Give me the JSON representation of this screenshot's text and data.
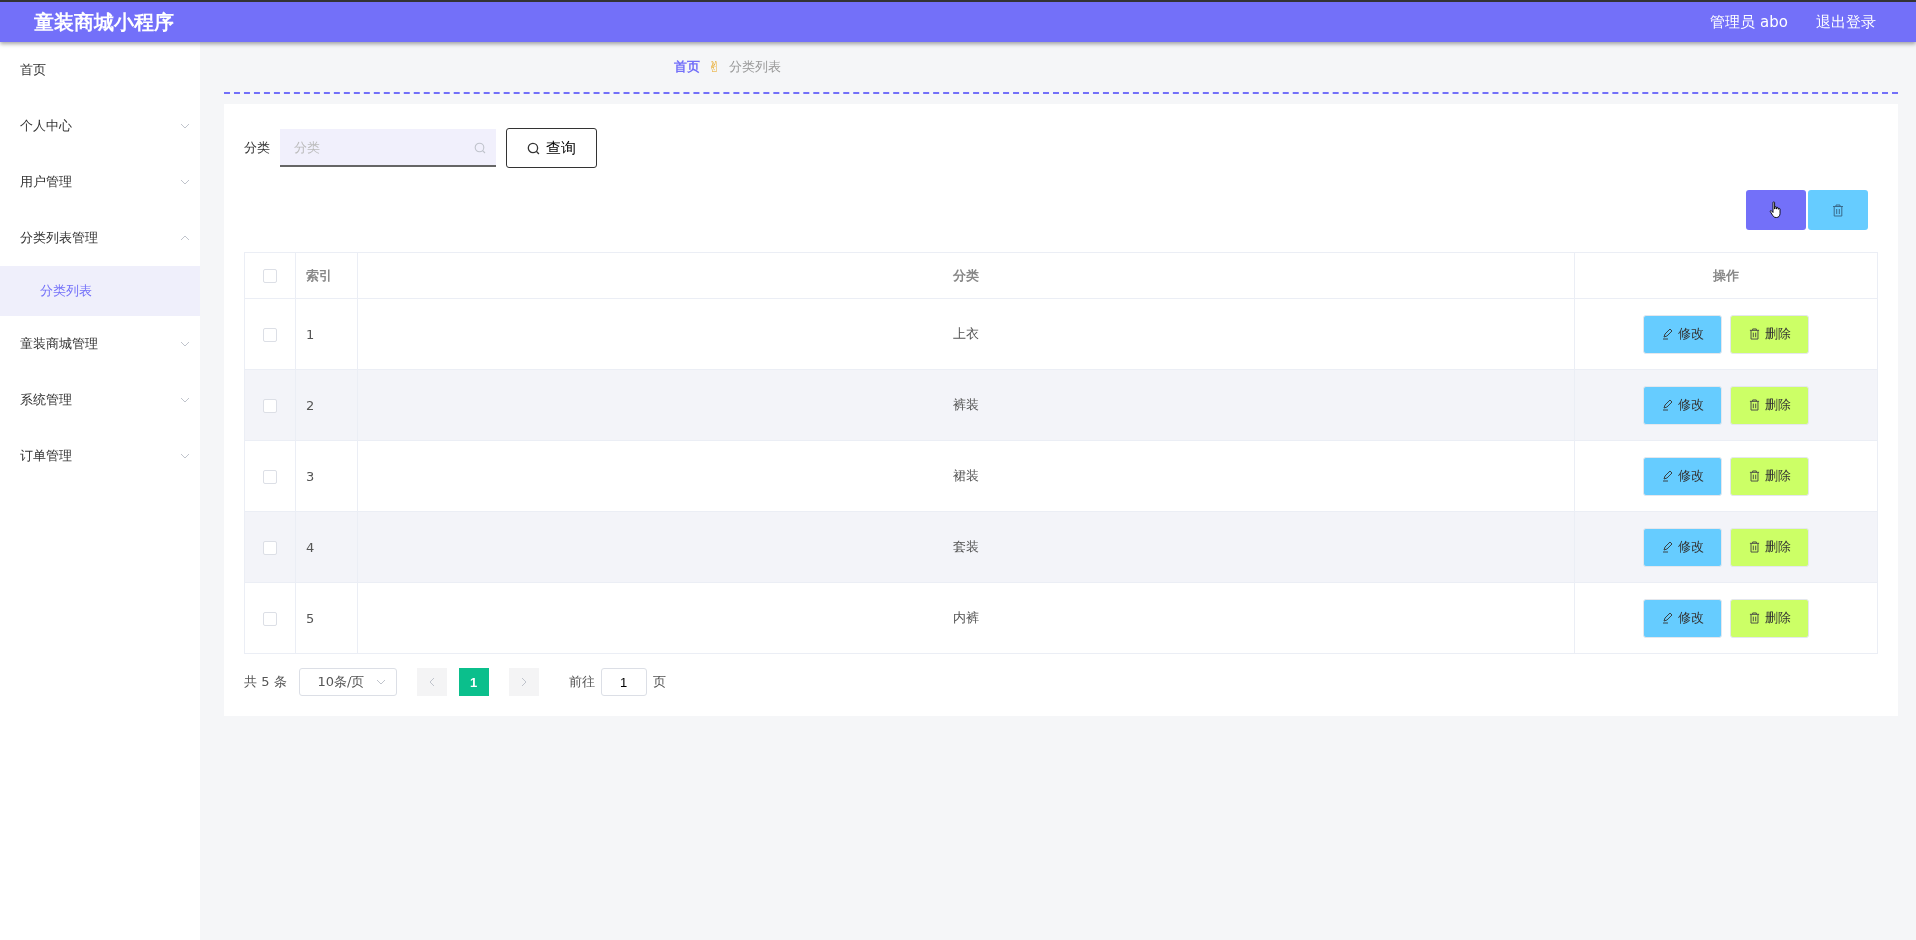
{
  "header": {
    "title": "童装商城小程序",
    "user": "管理员 abo",
    "logout": "退出登录"
  },
  "sidebar": {
    "items": [
      {
        "label": "首页"
      },
      {
        "label": "个人中心",
        "expanded": false
      },
      {
        "label": "用户管理",
        "expanded": false
      },
      {
        "label": "分类列表管理",
        "expanded": true,
        "children": [
          {
            "label": "分类列表",
            "selected": true
          }
        ]
      },
      {
        "label": "童装商城管理",
        "expanded": false
      },
      {
        "label": "系统管理",
        "expanded": false
      },
      {
        "label": "订单管理",
        "expanded": false
      }
    ]
  },
  "breadcrumb": {
    "items": [
      "首页",
      "分类列表"
    ],
    "separator": "✌"
  },
  "search": {
    "label": "分类",
    "placeholder": "分类",
    "button": "查询"
  },
  "table": {
    "all_checked": false,
    "columns": [
      "索引",
      "分类",
      "操作"
    ],
    "rows": [
      {
        "index": "1",
        "category": "上衣",
        "checked": false,
        "actions": [
          "修改",
          "删除"
        ]
      },
      {
        "index": "2",
        "category": "裤装",
        "checked": false,
        "actions": [
          "修改",
          "删除"
        ]
      },
      {
        "index": "3",
        "category": "裙装",
        "checked": false,
        "actions": [
          "修改",
          "删除"
        ]
      },
      {
        "index": "4",
        "category": "套装",
        "checked": false,
        "actions": [
          "修改",
          "删除"
        ]
      },
      {
        "index": "5",
        "category": "内裤",
        "checked": false,
        "actions": [
          "修改",
          "删除"
        ]
      }
    ]
  },
  "pagination": {
    "total": "共 5 条",
    "page_size": "10条/页",
    "pages": [
      {
        "label": "1",
        "selected": true
      }
    ],
    "goto_label": "前往",
    "goto_value": "1",
    "goto_suffix": "页"
  }
}
